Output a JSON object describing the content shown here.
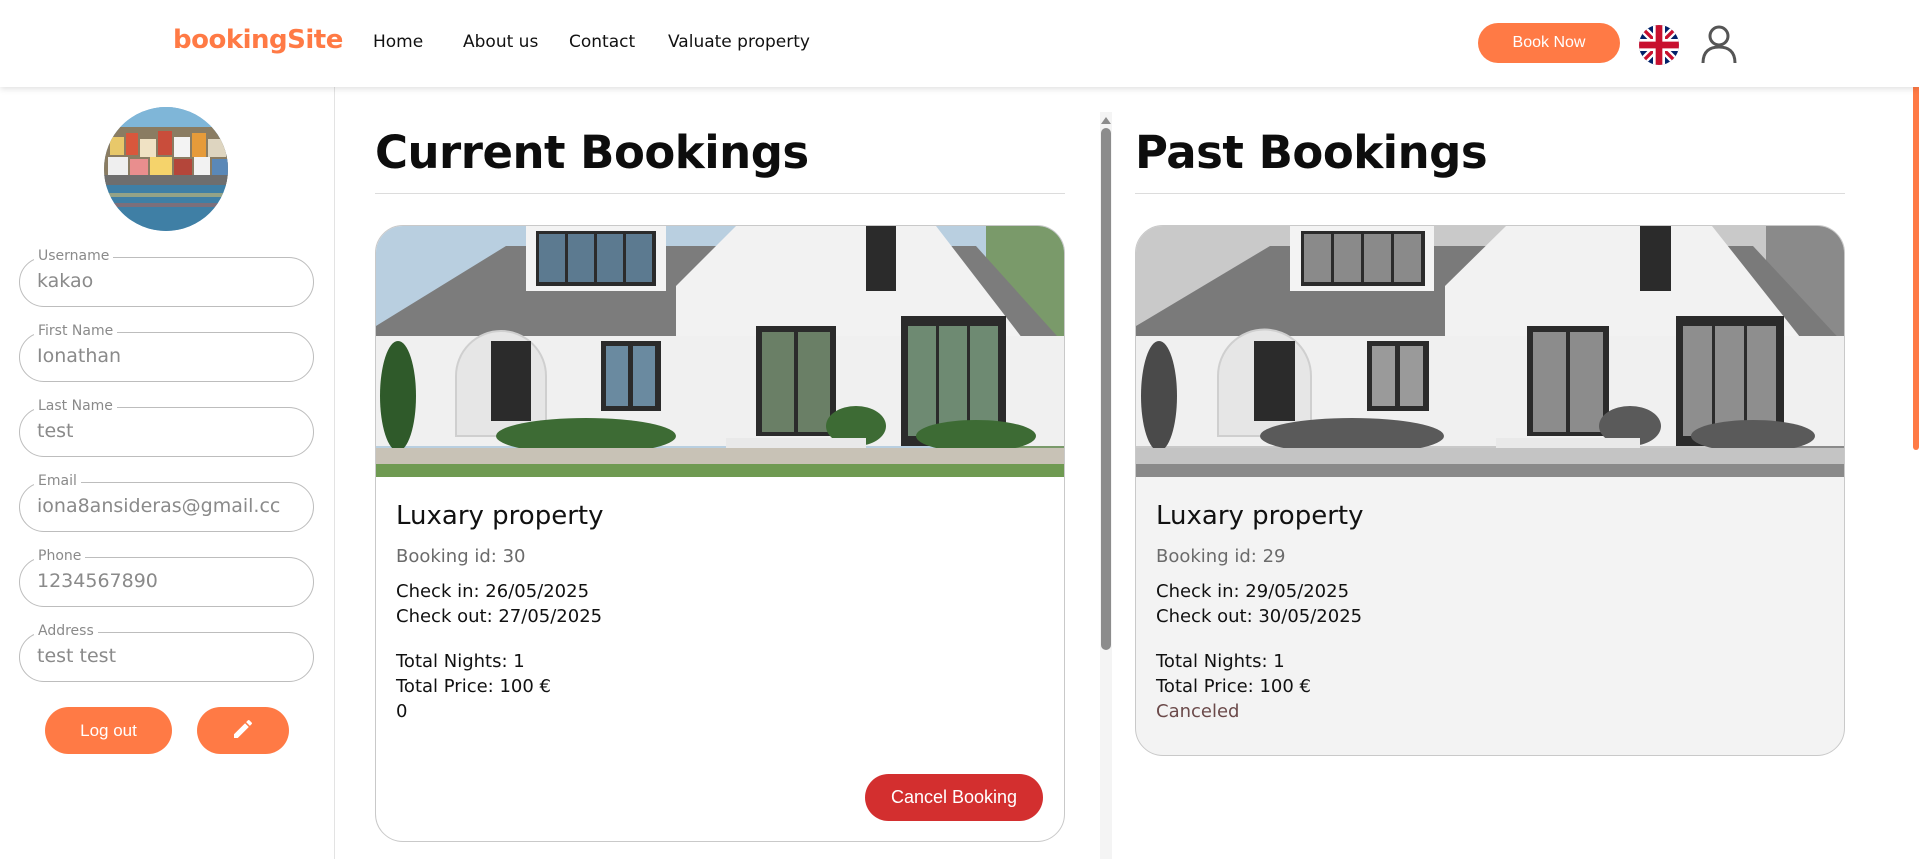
{
  "header": {
    "brand": "bookingSite",
    "nav": [
      "Home",
      "About us",
      "Contact",
      "Valuate property"
    ],
    "book_now": "Book Now",
    "language_flag": "uk-flag-icon",
    "user_icon": "user-icon"
  },
  "profile": {
    "avatar": "avatar-photo",
    "fields": [
      {
        "label": "Username",
        "value": "kakao"
      },
      {
        "label": "First Name",
        "value": "Ionathan"
      },
      {
        "label": "Last Name",
        "value": "test"
      },
      {
        "label": "Email",
        "value": "iona8ansideras@gmail.cc"
      },
      {
        "label": "Phone",
        "value": "1234567890"
      },
      {
        "label": "Address",
        "value": "test test"
      }
    ],
    "logout": "Log out",
    "edit_icon": "pencil-icon"
  },
  "current": {
    "title": "Current Bookings",
    "bookings": [
      {
        "name": "Luxary property",
        "booking_id": "Booking id: 30",
        "check_in": "Check in: 26/05/2025",
        "check_out": "Check out: 27/05/2025",
        "nights": "Total Nights: 1",
        "price": "Total Price: 100 €",
        "status": "0",
        "action": "Cancel Booking"
      }
    ]
  },
  "past": {
    "title": "Past Bookings",
    "bookings": [
      {
        "name": "Luxary property",
        "booking_id": "Booking id: 29",
        "check_in": "Check in: 29/05/2025",
        "check_out": "Check out: 30/05/2025",
        "nights": "Total Nights: 1",
        "price": "Total Price: 100 €",
        "status": "Canceled"
      }
    ]
  },
  "colors": {
    "accent": "#ff7a45",
    "danger": "#d32f2f"
  }
}
